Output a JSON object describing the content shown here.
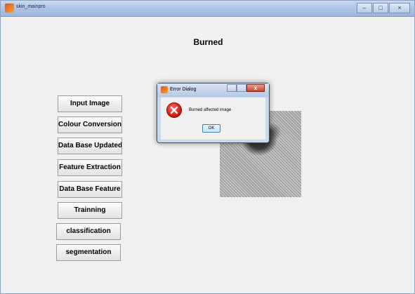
{
  "window": {
    "title": "skin_mainpro",
    "controls": [
      "minimize",
      "maximize",
      "close"
    ]
  },
  "main": {
    "heading": "Burned",
    "buttons": [
      {
        "label": "Input Image"
      },
      {
        "label": "Colour Conversion"
      },
      {
        "label": "Data Base Updated"
      },
      {
        "label": "Feature Extraction"
      },
      {
        "label": "Data Base Feature"
      },
      {
        "label": "Trainning"
      },
      {
        "label": "classification"
      },
      {
        "label": "segmentation"
      }
    ]
  },
  "dialog": {
    "title": "Error Dialog",
    "message": "Burned affected image",
    "ok_label": "OK",
    "close_glyph": "x"
  }
}
